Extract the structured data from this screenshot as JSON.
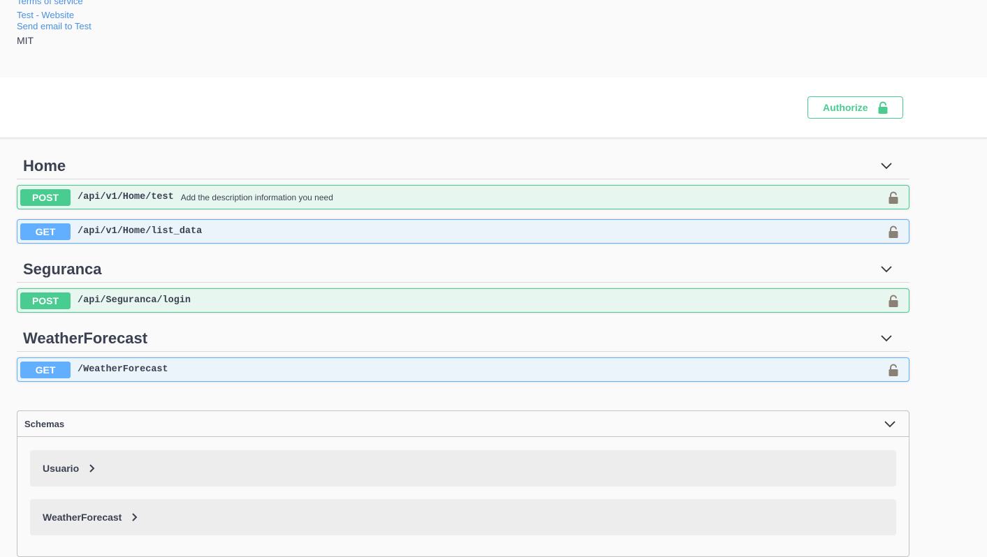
{
  "info": {
    "terms_of_service": "Terms of service",
    "website_link": "Test - Website",
    "email_link": "Send email to Test",
    "license": "MIT"
  },
  "scheme": {
    "authorize_label": "Authorize"
  },
  "tags": [
    {
      "name": "Home",
      "operations": [
        {
          "method": "POST",
          "path": "/api/v1/Home/test",
          "description": "Add the description information you need"
        },
        {
          "method": "GET",
          "path": "/api/v1/Home/list_data",
          "description": ""
        }
      ]
    },
    {
      "name": "Seguranca",
      "operations": [
        {
          "method": "POST",
          "path": "/api/Seguranca/login",
          "description": ""
        }
      ]
    },
    {
      "name": "WeatherForecast",
      "operations": [
        {
          "method": "GET",
          "path": "/WeatherForecast",
          "description": ""
        }
      ]
    }
  ],
  "schemas": {
    "title": "Schemas",
    "models": [
      "Usuario",
      "WeatherForecast"
    ]
  },
  "icons": {
    "lock": "lock-icon",
    "chevron": "chevron-down-icon",
    "model_chevron": "chevron-right-icon"
  },
  "colors": {
    "post": "#49cc90",
    "get": "#61affe",
    "link": "#4990e2",
    "text": "#3b4151"
  }
}
